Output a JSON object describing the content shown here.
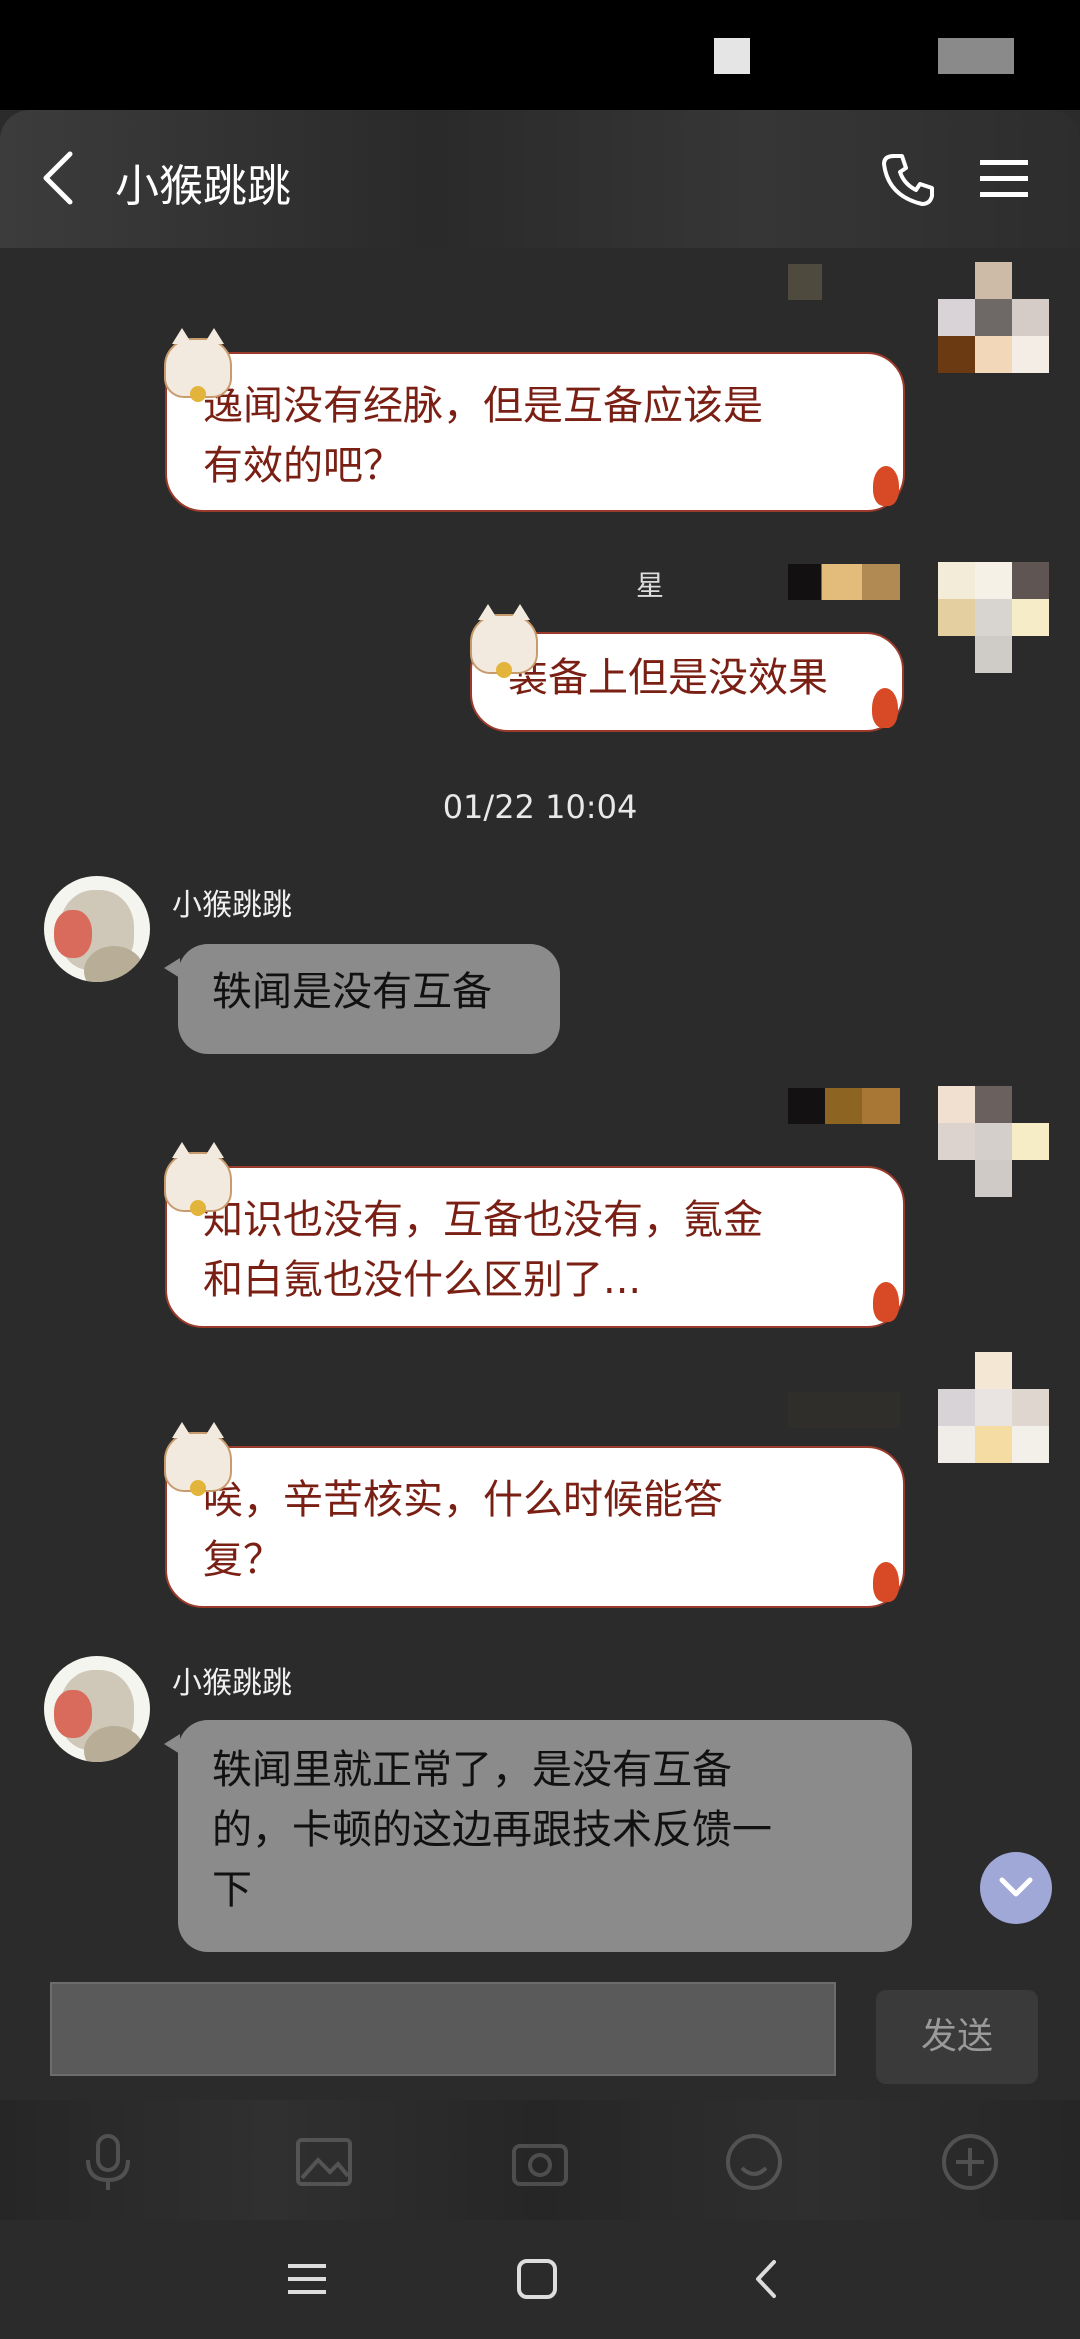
{
  "header": {
    "title": "小猴跳跳"
  },
  "messages": {
    "m1": {
      "line1": "逸闻没有经脉，但是互备应该是",
      "line2": "有效的吧？"
    },
    "m2_sender_label": "星",
    "m2": {
      "text": "装备上但是没效果"
    },
    "timestamp": "01/22 10:04",
    "m3": {
      "sender": "小猴跳跳",
      "text": "轶闻是没有互备"
    },
    "m4": {
      "line1": "知识也没有，互备也没有，氪金",
      "line2": "和白氪也没什么区别了..."
    },
    "m5": {
      "line1": "唉，辛苦核实，什么时候能答",
      "line2": "复？"
    },
    "m6": {
      "sender": "小猴跳跳",
      "line1": "轶闻里就正常了，是没有互备",
      "line2": "的，卡顿的这边再跟技术反馈一",
      "line3": "下"
    }
  },
  "input": {
    "value": "",
    "send_label": "发送"
  },
  "colors": {
    "background": "#2b2b2b",
    "bubble_out_bg": "#ffffff",
    "bubble_out_text": "#7a1f13",
    "bubble_in_bg": "#8b8b8b",
    "accent": "#9fa8d6"
  },
  "icons": [
    "back-icon",
    "phone-icon",
    "menu-icon",
    "chevron-down-icon",
    "microphone-icon",
    "image-icon",
    "camera-icon",
    "emoji-icon",
    "plus-icon",
    "nav-menu-icon",
    "nav-home-icon",
    "nav-back-icon"
  ]
}
